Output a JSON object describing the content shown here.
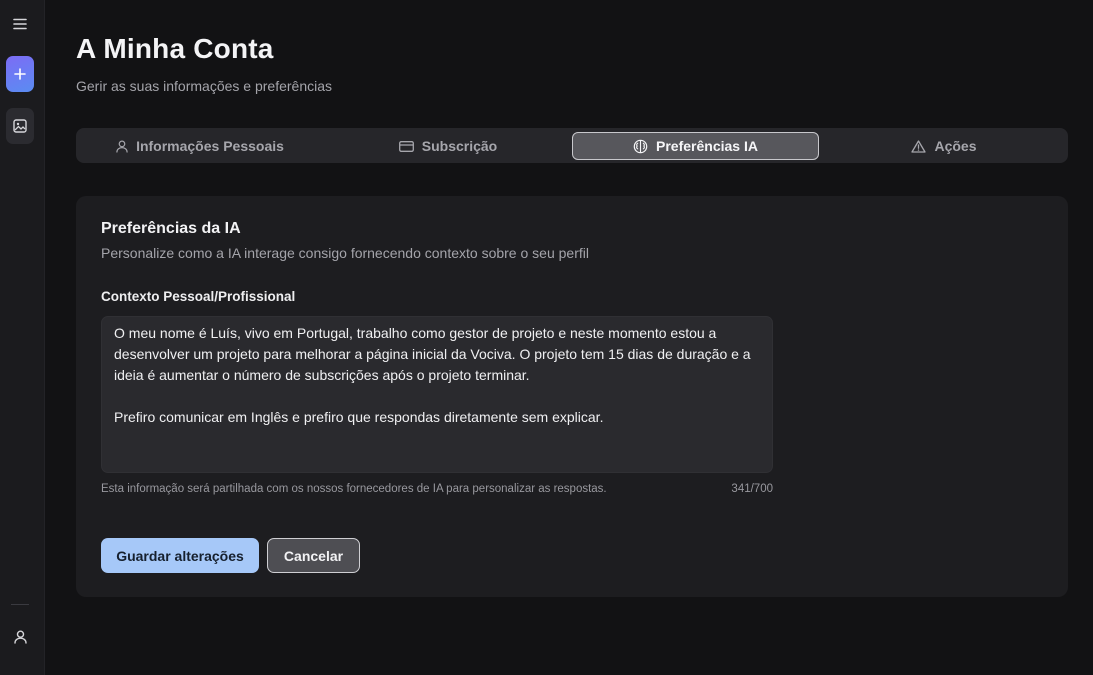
{
  "sidebar": {
    "menu_icon": "hamburger-menu-icon",
    "new_icon": "plus-icon",
    "gallery_icon": "image-icon",
    "user_icon": "user-icon",
    "new_button_gradient": [
      "#7c6cf5",
      "#5a8cf2"
    ]
  },
  "header": {
    "title": "A Minha Conta",
    "subtitle": "Gerir as suas informações e preferências"
  },
  "tabs": [
    {
      "label": "Informações Pessoais",
      "icon": "user-icon",
      "active": false
    },
    {
      "label": "Subscrição",
      "icon": "credit-card-icon",
      "active": false
    },
    {
      "label": "Preferências IA",
      "icon": "brain-icon",
      "active": true
    },
    {
      "label": "Ações",
      "icon": "warning-triangle-icon",
      "active": false
    }
  ],
  "card": {
    "title": "Preferências da IA",
    "description": "Personalize como a IA interage consigo fornecendo contexto sobre o seu perfil",
    "field_label": "Contexto Pessoal/Profissional",
    "context_value": "O meu nome é Luís, vivo em Portugal, trabalho como gestor de projeto e neste momento estou a desenvolver um projeto para melhorar a página inicial da Vociva. O projeto tem 15 dias de duração e a ideia é aumentar o número de subscrições após o projeto terminar.\n\nPrefiro comunicar em Inglês e prefiro que respondas diretamente sem explicar.",
    "help_text": "Esta informação será partilhada com os nossos fornecedores de IA para personalizar as respostas.",
    "char_count": "341/700",
    "save_label": "Guardar alterações",
    "cancel_label": "Cancelar"
  },
  "colors": {
    "accent_button": "#a6c8f8",
    "background": "#121214",
    "card": "#1d1d20"
  }
}
